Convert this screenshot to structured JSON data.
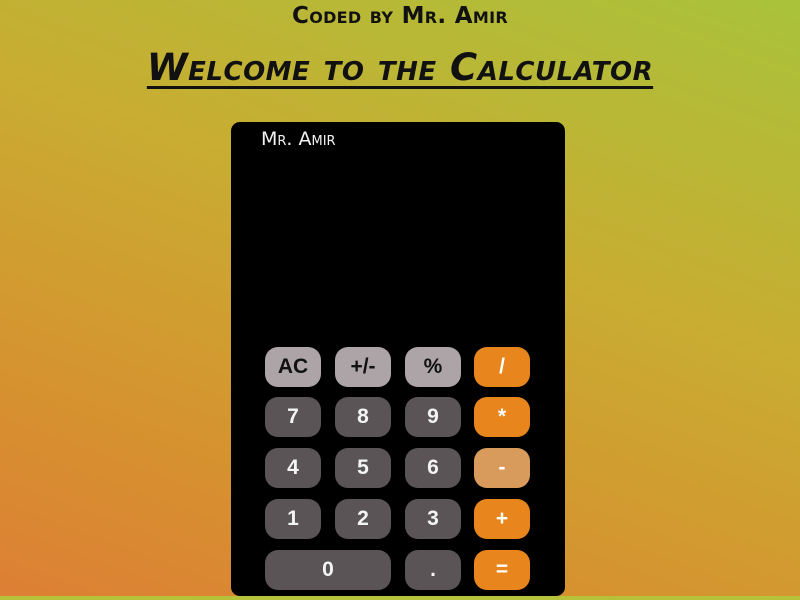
{
  "header": {
    "credit": "Coded by Mr. Amir",
    "title": "Welcome to the Calculator"
  },
  "calculator": {
    "owner_label": "Mr. Amir",
    "display_value": "",
    "keys": {
      "ac": "AC",
      "sign": "+/-",
      "percent": "%",
      "divide": "/",
      "seven": "7",
      "eight": "8",
      "nine": "9",
      "multiply": "*",
      "four": "4",
      "five": "5",
      "six": "6",
      "subtract": "-",
      "one": "1",
      "two": "2",
      "three": "3",
      "add": "+",
      "zero": "0",
      "decimal": ".",
      "equals": "="
    }
  },
  "colors": {
    "function_key": "#aca4a6",
    "number_key": "#5a5456",
    "operator_key": "#e8851c",
    "operator_key_muted": "#d99b5c",
    "calculator_body": "#000000"
  }
}
